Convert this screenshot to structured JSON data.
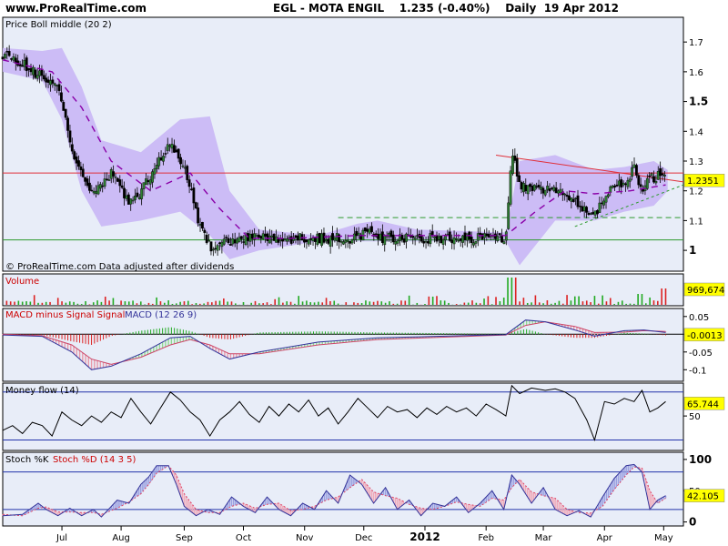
{
  "header": {
    "site": "www.ProRealTime.com",
    "title": "EGL - MOTA ENGIL    1.235 (-0.40%)    Daily  19 Apr 2012"
  },
  "colors": {
    "panel_bg": "#e8edf8",
    "boll_band": "#c9b6f5",
    "boll_middle": "#8a00a8",
    "candle_up": "#2e7d32",
    "resistance_red": "#e0303a",
    "support_green": "#2e9a2e",
    "volume_up": "#22aa22",
    "volume_down": "#dd2222",
    "macd_line": "#333399",
    "signal_line": "#cc4466",
    "osc_line": "#000000",
    "stoch_k": "#333399",
    "stoch_d": "#dd4466",
    "badge": "#ffff00"
  },
  "panels": {
    "price": {
      "label": "Price Boll middle (20 2)",
      "footer": "© ProRealTime.com  Data adjusted after dividends"
    },
    "volume": {
      "label": "Volume"
    },
    "macd": {
      "label_a": "MACD minus Signal Signal",
      "label_b": "MACD (12 26 9)"
    },
    "money": {
      "label": "Money flow (14)"
    },
    "stoch": {
      "label_a": "Stoch %K",
      "label_b": "Stoch %D (14 3 5)"
    }
  },
  "chart_data": [
    {
      "type": "candlestick",
      "title": "Price Boll middle (20 2)",
      "ylim": [
        0.93,
        1.78
      ],
      "y_ticks": [
        "1.7",
        "1.6",
        "1.5",
        "1.4",
        "1.3",
        "1.2",
        "1.1",
        "1"
      ],
      "last_value": "1.2351",
      "x_ticks": [
        "Jul",
        "Aug",
        "Sep",
        "Oct",
        "Nov",
        "Dec",
        "2012",
        "Feb",
        "Mar",
        "Apr",
        "May"
      ],
      "close_trace": [
        [
          0,
          1.66
        ],
        [
          10,
          1.63
        ],
        [
          20,
          1.58
        ],
        [
          28,
          1.55
        ],
        [
          35,
          1.35
        ],
        [
          40,
          1.25
        ],
        [
          45,
          1.2
        ],
        [
          50,
          1.22
        ],
        [
          55,
          1.26
        ],
        [
          60,
          1.2
        ],
        [
          65,
          1.16
        ],
        [
          70,
          1.2
        ],
        [
          78,
          1.28
        ],
        [
          84,
          1.36
        ],
        [
          88,
          1.32
        ],
        [
          92,
          1.28
        ],
        [
          96,
          1.18
        ],
        [
          100,
          1.08
        ],
        [
          104,
          1.02
        ],
        [
          108,
          1.0
        ],
        [
          112,
          1.03
        ],
        [
          118,
          1.03
        ],
        [
          125,
          1.04
        ],
        [
          135,
          1.04
        ],
        [
          150,
          1.04
        ],
        [
          170,
          1.04
        ],
        [
          180,
          1.04
        ],
        [
          185,
          1.07
        ],
        [
          190,
          1.04
        ],
        [
          205,
          1.04
        ],
        [
          230,
          1.04
        ],
        [
          245,
          1.04
        ],
        [
          255,
          1.04
        ],
        [
          258,
          1.33
        ],
        [
          262,
          1.22
        ],
        [
          270,
          1.21
        ],
        [
          280,
          1.2
        ],
        [
          290,
          1.17
        ],
        [
          296,
          1.12
        ],
        [
          300,
          1.12
        ],
        [
          306,
          1.2
        ],
        [
          312,
          1.22
        ],
        [
          316,
          1.23
        ],
        [
          320,
          1.28
        ],
        [
          324,
          1.2
        ],
        [
          328,
          1.24
        ],
        [
          332,
          1.25
        ],
        [
          336,
          1.235
        ]
      ],
      "boll_upper": [
        [
          0,
          1.68
        ],
        [
          20,
          1.67
        ],
        [
          30,
          1.68
        ],
        [
          40,
          1.55
        ],
        [
          50,
          1.37
        ],
        [
          70,
          1.33
        ],
        [
          90,
          1.44
        ],
        [
          105,
          1.45
        ],
        [
          115,
          1.2
        ],
        [
          130,
          1.07
        ],
        [
          160,
          1.05
        ],
        [
          180,
          1.09
        ],
        [
          190,
          1.1
        ],
        [
          210,
          1.07
        ],
        [
          255,
          1.06
        ],
        [
          262,
          1.3
        ],
        [
          280,
          1.32
        ],
        [
          300,
          1.27
        ],
        [
          315,
          1.28
        ],
        [
          330,
          1.3
        ],
        [
          337,
          1.27
        ]
      ],
      "boll_lower": [
        [
          0,
          1.6
        ],
        [
          20,
          1.57
        ],
        [
          30,
          1.44
        ],
        [
          40,
          1.2
        ],
        [
          50,
          1.08
        ],
        [
          70,
          1.1
        ],
        [
          90,
          1.13
        ],
        [
          105,
          1.05
        ],
        [
          115,
          0.97
        ],
        [
          130,
          1.0
        ],
        [
          160,
          1.03
        ],
        [
          180,
          1.03
        ],
        [
          190,
          1.03
        ],
        [
          210,
          1.03
        ],
        [
          255,
          1.03
        ],
        [
          262,
          0.95
        ],
        [
          280,
          1.1
        ],
        [
          300,
          1.1
        ],
        [
          315,
          1.13
        ],
        [
          330,
          1.15
        ],
        [
          337,
          1.2
        ]
      ],
      "boll_middle": [
        [
          0,
          1.64
        ],
        [
          25,
          1.6
        ],
        [
          40,
          1.48
        ],
        [
          55,
          1.3
        ],
        [
          75,
          1.2
        ],
        [
          95,
          1.26
        ],
        [
          110,
          1.14
        ],
        [
          125,
          1.04
        ],
        [
          145,
          1.04
        ],
        [
          180,
          1.05
        ],
        [
          200,
          1.05
        ],
        [
          255,
          1.05
        ],
        [
          270,
          1.13
        ],
        [
          285,
          1.2
        ],
        [
          300,
          1.19
        ],
        [
          318,
          1.2
        ],
        [
          336,
          1.22
        ]
      ],
      "resistance_line": 1.26,
      "support_line": 1.035,
      "dashed_support": 1.11,
      "trend_down": [
        [
          250,
          1.32
        ],
        [
          345,
          1.23
        ]
      ],
      "trend_up": [
        [
          290,
          1.08
        ],
        [
          345,
          1.22
        ]
      ]
    },
    {
      "type": "bar",
      "title": "Volume",
      "last_value": "969,674"
    },
    {
      "type": "histogram",
      "title": "MACD (12 26 9)",
      "ylim": [
        -0.13,
        0.07
      ],
      "y_ticks": [
        "0.05",
        "0",
        "-0.05",
        "-0.1"
      ],
      "last_value": "-0.0013",
      "macd": [
        [
          0,
          -0.002
        ],
        [
          20,
          -0.006
        ],
        [
          35,
          -0.05
        ],
        [
          45,
          -0.1
        ],
        [
          55,
          -0.09
        ],
        [
          70,
          -0.055
        ],
        [
          85,
          -0.01
        ],
        [
          95,
          -0.006
        ],
        [
          105,
          -0.04
        ],
        [
          115,
          -0.07
        ],
        [
          130,
          -0.05
        ],
        [
          160,
          -0.022
        ],
        [
          190,
          -0.01
        ],
        [
          240,
          -0.003
        ],
        [
          255,
          -0.001
        ],
        [
          265,
          0.04
        ],
        [
          275,
          0.035
        ],
        [
          290,
          0.012
        ],
        [
          300,
          -0.005
        ],
        [
          315,
          0.01
        ],
        [
          325,
          0.012
        ],
        [
          336,
          0.005
        ]
      ],
      "signal": [
        [
          0,
          0.0
        ],
        [
          20,
          -0.004
        ],
        [
          35,
          -0.03
        ],
        [
          45,
          -0.07
        ],
        [
          55,
          -0.085
        ],
        [
          70,
          -0.065
        ],
        [
          85,
          -0.03
        ],
        [
          95,
          -0.015
        ],
        [
          105,
          -0.03
        ],
        [
          115,
          -0.055
        ],
        [
          130,
          -0.055
        ],
        [
          160,
          -0.03
        ],
        [
          190,
          -0.015
        ],
        [
          240,
          -0.005
        ],
        [
          255,
          -0.002
        ],
        [
          265,
          0.025
        ],
        [
          275,
          0.035
        ],
        [
          290,
          0.022
        ],
        [
          300,
          0.005
        ],
        [
          315,
          0.006
        ],
        [
          325,
          0.01
        ],
        [
          336,
          0.008
        ]
      ]
    },
    {
      "type": "line",
      "title": "Money flow (14)",
      "ylim": [
        8,
        90
      ],
      "y_ticks": [
        "50"
      ],
      "last_value": "65.744",
      "series": [
        [
          0,
          32
        ],
        [
          5,
          38
        ],
        [
          10,
          28
        ],
        [
          15,
          42
        ],
        [
          20,
          38
        ],
        [
          25,
          25
        ],
        [
          30,
          55
        ],
        [
          35,
          45
        ],
        [
          40,
          38
        ],
        [
          45,
          50
        ],
        [
          50,
          42
        ],
        [
          55,
          55
        ],
        [
          60,
          48
        ],
        [
          65,
          72
        ],
        [
          70,
          55
        ],
        [
          75,
          40
        ],
        [
          80,
          60
        ],
        [
          85,
          80
        ],
        [
          90,
          70
        ],
        [
          95,
          55
        ],
        [
          100,
          45
        ],
        [
          105,
          25
        ],
        [
          110,
          45
        ],
        [
          115,
          55
        ],
        [
          120,
          68
        ],
        [
          125,
          52
        ],
        [
          130,
          42
        ],
        [
          135,
          62
        ],
        [
          140,
          50
        ],
        [
          145,
          65
        ],
        [
          150,
          55
        ],
        [
          155,
          70
        ],
        [
          160,
          50
        ],
        [
          165,
          60
        ],
        [
          170,
          40
        ],
        [
          175,
          55
        ],
        [
          180,
          72
        ],
        [
          185,
          60
        ],
        [
          190,
          48
        ],
        [
          195,
          62
        ],
        [
          200,
          55
        ],
        [
          205,
          58
        ],
        [
          210,
          48
        ],
        [
          215,
          60
        ],
        [
          220,
          52
        ],
        [
          225,
          62
        ],
        [
          230,
          55
        ],
        [
          235,
          60
        ],
        [
          240,
          50
        ],
        [
          245,
          65
        ],
        [
          250,
          58
        ],
        [
          255,
          50
        ],
        [
          258,
          88
        ],
        [
          262,
          78
        ],
        [
          268,
          85
        ],
        [
          275,
          82
        ],
        [
          280,
          84
        ],
        [
          285,
          80
        ],
        [
          290,
          72
        ],
        [
          296,
          45
        ],
        [
          300,
          20
        ],
        [
          305,
          68
        ],
        [
          310,
          65
        ],
        [
          315,
          72
        ],
        [
          320,
          68
        ],
        [
          324,
          82
        ],
        [
          328,
          55
        ],
        [
          332,
          60
        ],
        [
          336,
          68
        ]
      ]
    },
    {
      "type": "line",
      "title": "Stoch %K Stoch %D (14 3 5)",
      "ylim": [
        -5,
        110
      ],
      "y_ticks": [
        "100",
        "50",
        "0"
      ],
      "last_value": "42.105",
      "k": [
        [
          0,
          10
        ],
        [
          10,
          12
        ],
        [
          18,
          30
        ],
        [
          22,
          20
        ],
        [
          28,
          10
        ],
        [
          34,
          22
        ],
        [
          40,
          10
        ],
        [
          46,
          20
        ],
        [
          50,
          8
        ],
        [
          58,
          35
        ],
        [
          64,
          30
        ],
        [
          70,
          60
        ],
        [
          74,
          72
        ],
        [
          78,
          90
        ],
        [
          84,
          90
        ],
        [
          88,
          60
        ],
        [
          92,
          25
        ],
        [
          98,
          10
        ],
        [
          104,
          20
        ],
        [
          110,
          12
        ],
        [
          116,
          40
        ],
        [
          122,
          25
        ],
        [
          128,
          15
        ],
        [
          134,
          40
        ],
        [
          140,
          20
        ],
        [
          146,
          10
        ],
        [
          152,
          30
        ],
        [
          158,
          20
        ],
        [
          164,
          50
        ],
        [
          170,
          30
        ],
        [
          176,
          75
        ],
        [
          182,
          60
        ],
        [
          188,
          30
        ],
        [
          194,
          55
        ],
        [
          200,
          20
        ],
        [
          206,
          35
        ],
        [
          212,
          10
        ],
        [
          218,
          30
        ],
        [
          224,
          25
        ],
        [
          230,
          40
        ],
        [
          236,
          15
        ],
        [
          242,
          30
        ],
        [
          248,
          50
        ],
        [
          254,
          20
        ],
        [
          258,
          75
        ],
        [
          262,
          60
        ],
        [
          268,
          30
        ],
        [
          274,
          55
        ],
        [
          280,
          20
        ],
        [
          286,
          10
        ],
        [
          292,
          18
        ],
        [
          298,
          8
        ],
        [
          304,
          40
        ],
        [
          310,
          70
        ],
        [
          316,
          90
        ],
        [
          320,
          92
        ],
        [
          324,
          80
        ],
        [
          328,
          20
        ],
        [
          332,
          35
        ],
        [
          336,
          42
        ]
      ],
      "d": [
        [
          0,
          12
        ],
        [
          10,
          10
        ],
        [
          18,
          22
        ],
        [
          22,
          24
        ],
        [
          28,
          16
        ],
        [
          34,
          16
        ],
        [
          40,
          15
        ],
        [
          46,
          15
        ],
        [
          50,
          12
        ],
        [
          58,
          22
        ],
        [
          64,
          32
        ],
        [
          70,
          45
        ],
        [
          74,
          60
        ],
        [
          78,
          78
        ],
        [
          84,
          90
        ],
        [
          88,
          75
        ],
        [
          92,
          45
        ],
        [
          98,
          20
        ],
        [
          104,
          15
        ],
        [
          110,
          15
        ],
        [
          116,
          25
        ],
        [
          122,
          30
        ],
        [
          128,
          22
        ],
        [
          134,
          28
        ],
        [
          140,
          30
        ],
        [
          146,
          18
        ],
        [
          152,
          20
        ],
        [
          158,
          25
        ],
        [
          164,
          35
        ],
        [
          170,
          40
        ],
        [
          176,
          55
        ],
        [
          182,
          68
        ],
        [
          188,
          48
        ],
        [
          194,
          42
        ],
        [
          200,
          38
        ],
        [
          206,
          28
        ],
        [
          212,
          22
        ],
        [
          218,
          20
        ],
        [
          224,
          25
        ],
        [
          230,
          32
        ],
        [
          236,
          28
        ],
        [
          242,
          25
        ],
        [
          248,
          38
        ],
        [
          254,
          35
        ],
        [
          258,
          55
        ],
        [
          262,
          68
        ],
        [
          268,
          48
        ],
        [
          274,
          42
        ],
        [
          280,
          38
        ],
        [
          286,
          20
        ],
        [
          292,
          15
        ],
        [
          298,
          14
        ],
        [
          304,
          25
        ],
        [
          310,
          52
        ],
        [
          316,
          75
        ],
        [
          320,
          88
        ],
        [
          324,
          86
        ],
        [
          328,
          50
        ],
        [
          332,
          30
        ],
        [
          336,
          38
        ]
      ]
    }
  ]
}
